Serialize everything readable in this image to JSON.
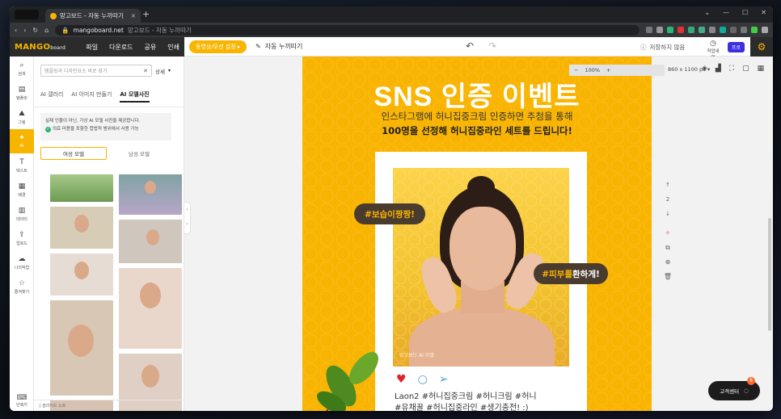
{
  "browser": {
    "tab_title": "망고보드 - 자동 누끼따기",
    "url_domain": "mangoboard.net",
    "url_rest": "망고보드 - 자동 누끼따기"
  },
  "header": {
    "logo": "MANGO",
    "logo_small": "board",
    "menu": [
      "파일",
      "다운로드",
      "공유",
      "인쇄"
    ],
    "edit_pill": "동영상/모션 설정 ▸",
    "filename": "자동 누끼따기",
    "saved": "저장하지 않음",
    "history": "작업내역",
    "pro": "프로"
  },
  "rail": {
    "items": [
      {
        "icon": "search-icon",
        "label": "검색"
      },
      {
        "icon": "template-icon",
        "label": "템플릿"
      },
      {
        "icon": "image-icon",
        "label": "그림"
      },
      {
        "icon": "ai-icon",
        "label": "AI"
      },
      {
        "icon": "text-icon",
        "label": "텍스트"
      },
      {
        "icon": "background-icon",
        "label": "배경"
      },
      {
        "icon": "chart-icon",
        "label": "데이터"
      },
      {
        "icon": "upload-icon",
        "label": "업로드"
      },
      {
        "icon": "my-work-icon",
        "label": "나의작업"
      },
      {
        "icon": "favorites-icon",
        "label": "즐겨찾기"
      }
    ],
    "footer": "단축키",
    "active_index": 3
  },
  "panel": {
    "search_placeholder": "템플릿과 디자인요소 바로 찾기",
    "detail": "상세",
    "tabs": [
      "AI 갤러리",
      "AI 이미지 만들기",
      "AI 모델사진"
    ],
    "active_tab": 2,
    "notice_line1": "실제 인물이 아닌, 가상 AI 모델 사진을 제공합니다.",
    "notice_line2": "의료·미용을 포함한 합법적 범위에서 사용 가능",
    "gender_tabs": [
      "여성 모델",
      "남성 모델"
    ],
    "active_gender": 0,
    "footer": "슬라이드 노트"
  },
  "toolbar": {
    "zoom": "100%",
    "size": "860 x 1100 px",
    "page": "2"
  },
  "design": {
    "title": "SNS 인증 이벤트",
    "sub1": "인스타그램에 허니집중크림 인증하면 추첨을 통해",
    "sub2": "100명을 선정해 허니집중라인 세트를 드립니다!",
    "bubble1": "#보습이짱짱!",
    "bubble2_a": "#피부를 ",
    "bubble2_b": "환하게!",
    "watermark": "망고보드 AI 모델",
    "caption1": "Laon2  #허니집중크림 #허니크림 #허니",
    "caption2": "#유채꿀 #허니집중라인 #생기충전! :)"
  },
  "chat": {
    "label": "고객센터",
    "badge": "8"
  },
  "colors": {
    "accent": "#f7b500",
    "dark": "#2b2b2b",
    "pro": "#3d2fe0"
  }
}
